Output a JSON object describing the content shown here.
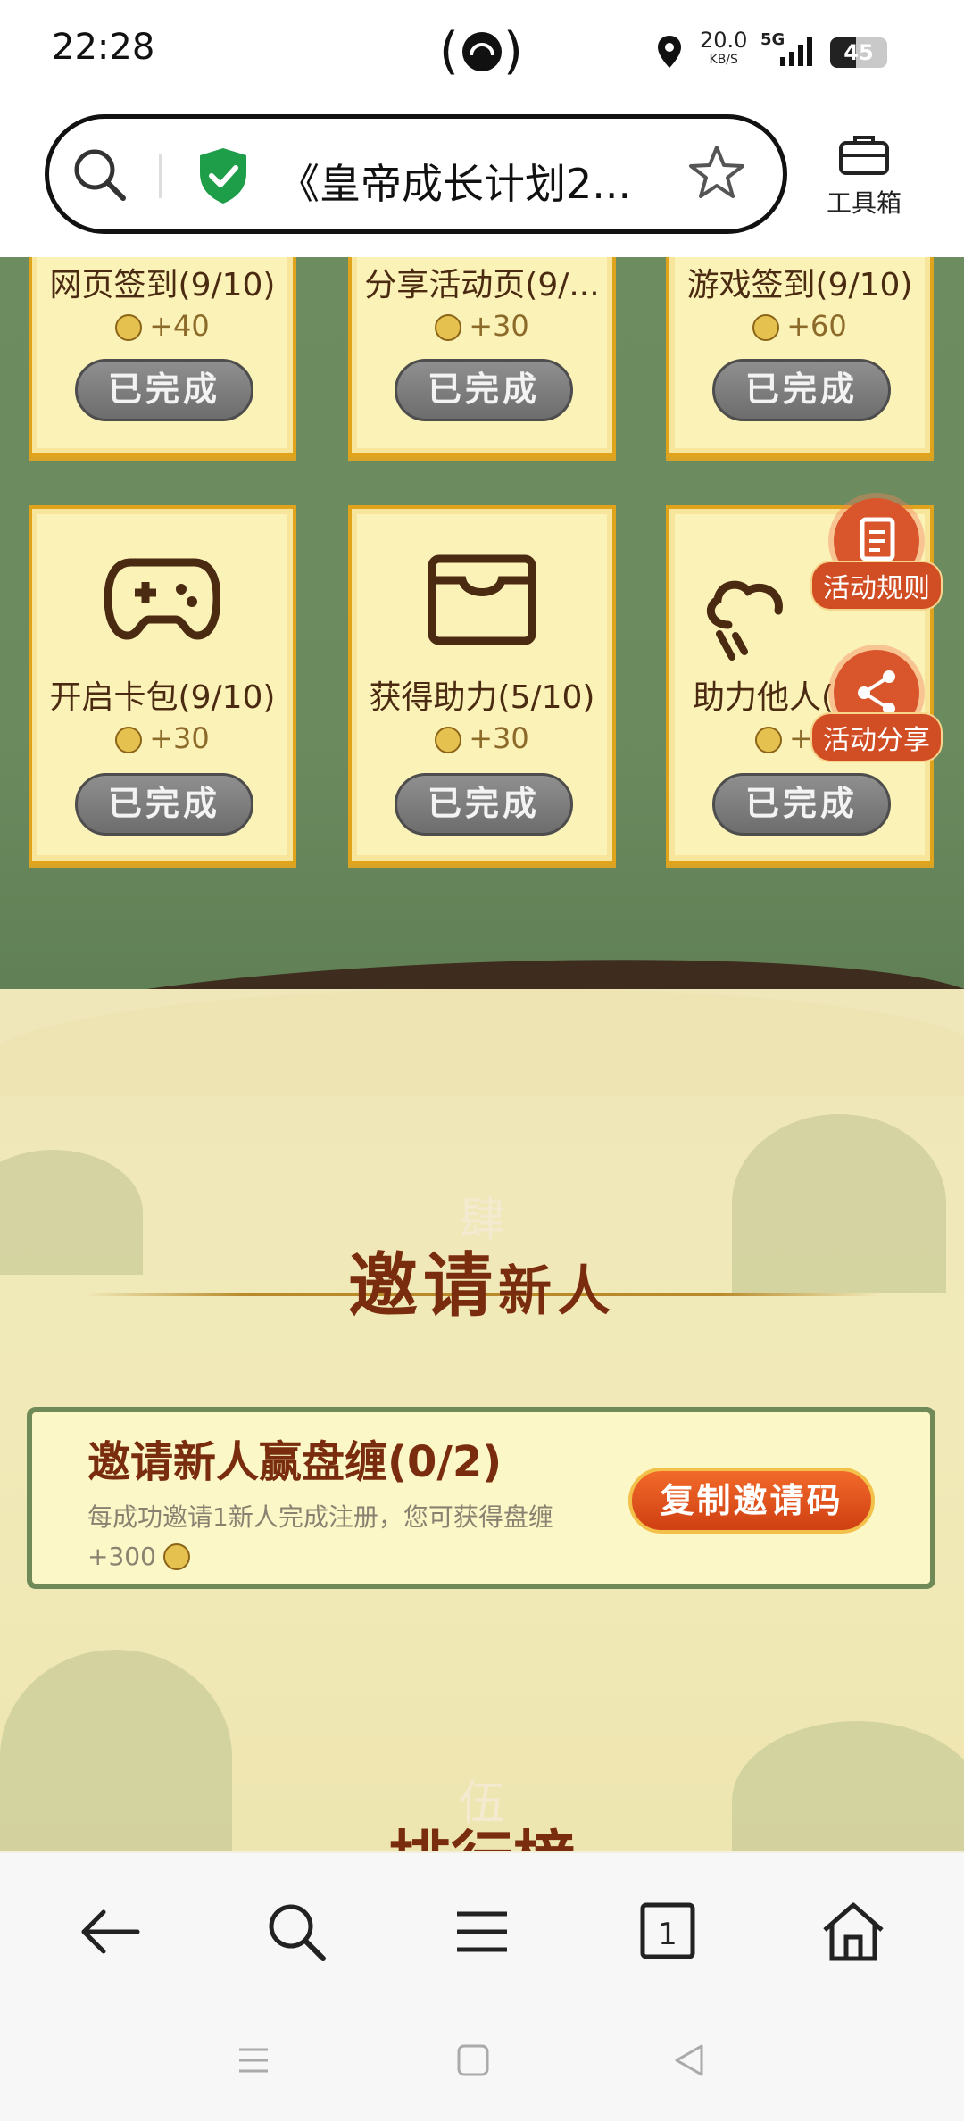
{
  "status_bar": {
    "time": "22:28",
    "speed_value": "20.0",
    "speed_unit": "KB/S",
    "network": "5G",
    "battery": "45",
    "battery_level_percent": 45
  },
  "browser": {
    "url_title": "《皇帝成长计划2...",
    "toolbox_label": "工具箱"
  },
  "tasks": [
    {
      "title": "网页签到(9/10)",
      "points": "+40",
      "button": "已完成"
    },
    {
      "title": "分享活动页(9/...",
      "points": "+30",
      "button": "已完成"
    },
    {
      "title": "游戏签到(9/10)",
      "points": "+60",
      "button": "已完成"
    },
    {
      "title": "开启卡包(9/10)",
      "points": "+30",
      "button": "已完成",
      "icon": "gamepad-icon"
    },
    {
      "title": "获得助力(5/10)",
      "points": "+30",
      "button": "已完成",
      "icon": "wallet-icon"
    },
    {
      "title": "助力他人(",
      "points": "+",
      "button": "已完成",
      "icon": "cloud-bird-icon"
    }
  ],
  "floating": {
    "rules_label": "活动规则",
    "share_label": "活动分享"
  },
  "invite_section": {
    "number_char": "肆",
    "title_main": "邀请",
    "title_sub": "新人",
    "card_title": "邀请新人赢盘缠(0/2)",
    "card_desc": "每成功邀请1新人完成注册，您可获得盘缠",
    "card_reward": "+300",
    "copy_button": "复制邀请码"
  },
  "next_section": {
    "number_char": "伍",
    "title": "排行榜"
  },
  "colors": {
    "green_bg": "#6b8b5f",
    "card_bg": "#fbf2b7",
    "card_border": "#e0a41c",
    "title_brown": "#7a2d0e",
    "accent_orange": "#d9562c"
  }
}
